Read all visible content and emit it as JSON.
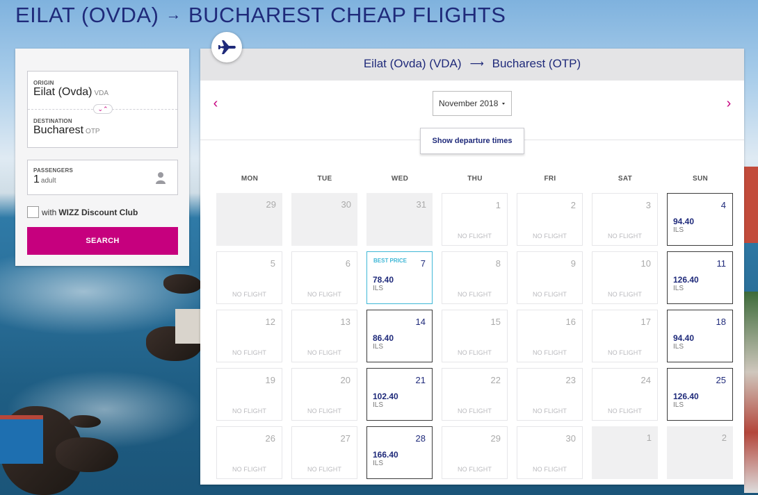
{
  "title": {
    "from": "EILAT (OVDA)",
    "arrow": "→",
    "to": "BUCHAREST CHEAP FLIGHTS"
  },
  "search": {
    "origin_label": "ORIGIN",
    "origin_value": "Eilat (Ovda)",
    "origin_code": "VDA",
    "destination_label": "DESTINATION",
    "destination_value": "Bucharest",
    "destination_code": "OTP",
    "passengers_label": "PASSENGERS",
    "passengers_count": "1",
    "passengers_unit": "adult",
    "discount_prefix": "with",
    "discount_name": "WIZZ Discount Club",
    "search_button": "SEARCH"
  },
  "calendar": {
    "route_from": "Eilat (Ovda) (VDA)",
    "route_arrow": "⟶",
    "route_to": "Bucharest (OTP)",
    "prev_icon": "‹",
    "next_icon": "›",
    "month": "November 2018",
    "departure_times_button": "Show departure times",
    "weekdays": [
      "MON",
      "TUE",
      "WED",
      "THU",
      "FRI",
      "SAT",
      "SUN"
    ],
    "no_flight_label": "NO FLIGHT",
    "best_price_label": "BEST PRICE",
    "weeks": [
      [
        {
          "day": "29",
          "state": "past"
        },
        {
          "day": "30",
          "state": "past"
        },
        {
          "day": "31",
          "state": "past"
        },
        {
          "day": "1",
          "state": "none"
        },
        {
          "day": "2",
          "state": "none"
        },
        {
          "day": "3",
          "state": "none"
        },
        {
          "day": "4",
          "state": "available",
          "price": "94.40",
          "currency": "ILS"
        }
      ],
      [
        {
          "day": "5",
          "state": "none"
        },
        {
          "day": "6",
          "state": "none"
        },
        {
          "day": "7",
          "state": "best",
          "price": "78.40",
          "currency": "ILS"
        },
        {
          "day": "8",
          "state": "none"
        },
        {
          "day": "9",
          "state": "none"
        },
        {
          "day": "10",
          "state": "none"
        },
        {
          "day": "11",
          "state": "available",
          "price": "126.40",
          "currency": "ILS"
        }
      ],
      [
        {
          "day": "12",
          "state": "none"
        },
        {
          "day": "13",
          "state": "none"
        },
        {
          "day": "14",
          "state": "available",
          "price": "86.40",
          "currency": "ILS"
        },
        {
          "day": "15",
          "state": "none"
        },
        {
          "day": "16",
          "state": "none"
        },
        {
          "day": "17",
          "state": "none"
        },
        {
          "day": "18",
          "state": "available",
          "price": "94.40",
          "currency": "ILS"
        }
      ],
      [
        {
          "day": "19",
          "state": "none"
        },
        {
          "day": "20",
          "state": "none"
        },
        {
          "day": "21",
          "state": "available",
          "price": "102.40",
          "currency": "ILS"
        },
        {
          "day": "22",
          "state": "none"
        },
        {
          "day": "23",
          "state": "none"
        },
        {
          "day": "24",
          "state": "none"
        },
        {
          "day": "25",
          "state": "available",
          "price": "126.40",
          "currency": "ILS"
        }
      ],
      [
        {
          "day": "26",
          "state": "none"
        },
        {
          "day": "27",
          "state": "none"
        },
        {
          "day": "28",
          "state": "available",
          "price": "166.40",
          "currency": "ILS"
        },
        {
          "day": "29",
          "state": "none"
        },
        {
          "day": "30",
          "state": "none"
        },
        {
          "day": "1",
          "state": "past"
        },
        {
          "day": "2",
          "state": "past"
        }
      ]
    ]
  },
  "colors": {
    "brand_navy": "#1f2a7a",
    "brand_magenta": "#c6007e",
    "best_price": "#3fb7d6"
  }
}
